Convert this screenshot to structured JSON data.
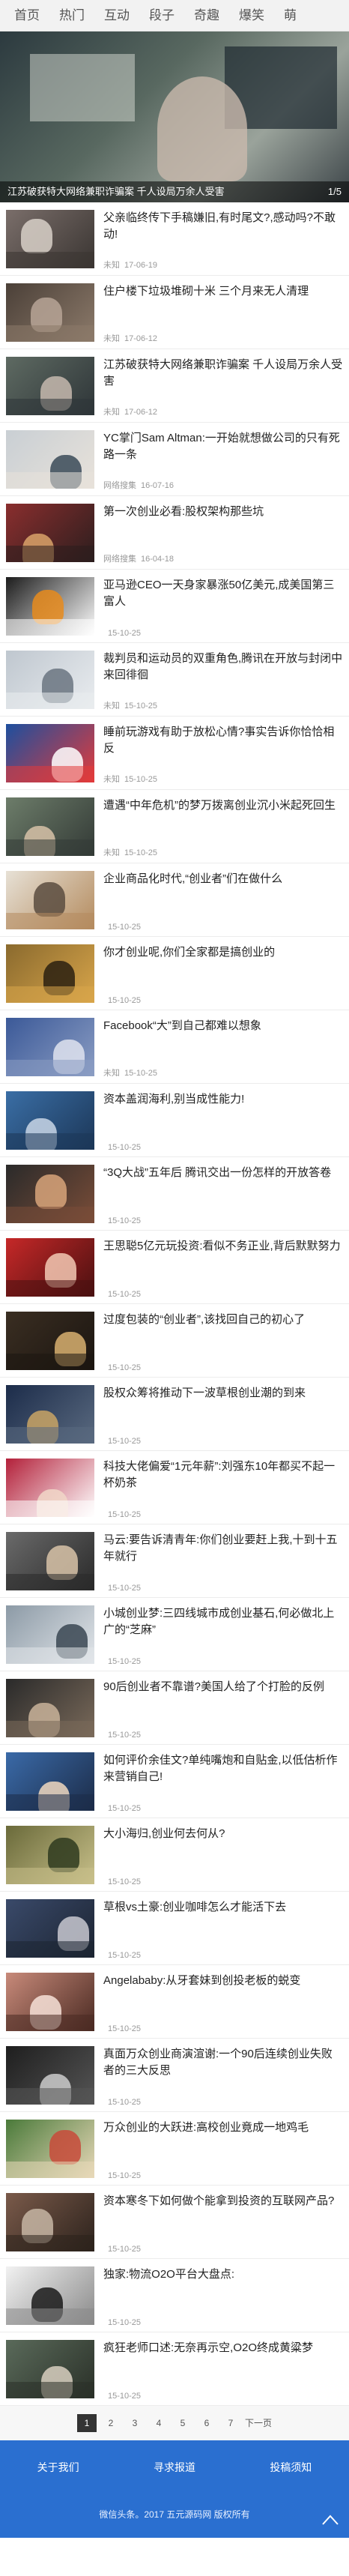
{
  "nav": [
    "首页",
    "热门",
    "互动",
    "段子",
    "奇趣",
    "爆笑",
    "萌"
  ],
  "slide": {
    "caption": "江苏破获特大网络兼职诈骗案 千人设局万余人受害",
    "counter": "1/5"
  },
  "items": [
    {
      "title": "父亲临终传下手稿嫌旧,有时尾文?,感动吗?不敢动!",
      "source": "未知",
      "date": "17-06-19",
      "colors": [
        "#7a6e6a",
        "#d8d0c8",
        "#3a3532"
      ]
    },
    {
      "title": "住户楼下垃圾堆砌十米 三个月来无人清理",
      "source": "未知",
      "date": "17-06-12",
      "colors": [
        "#4b4038",
        "#b7a596",
        "#8c7a6a"
      ]
    },
    {
      "title": "江苏破获特大网络兼职诈骗案 千人设局万余人受害",
      "source": "未知",
      "date": "17-06-12",
      "colors": [
        "#5e6a62",
        "#c6b9ae",
        "#2e3538"
      ]
    },
    {
      "title": "YC掌门Sam Altman:一开始就想做公司的只有死路一条",
      "source": "网络搜集",
      "date": "16-07-16",
      "colors": [
        "#c9cfd4",
        "#3a4a58",
        "#e8e2da"
      ]
    },
    {
      "title": "第一次创业必看:股权架构那些坑",
      "source": "网络搜集",
      "date": "16-04-18",
      "colors": [
        "#8a2e2e",
        "#d9a36a",
        "#2c1e1e"
      ]
    },
    {
      "title": "亚马逊CEO一天身家暴涨50亿美元,成美国第三富人",
      "source": "",
      "date": "15-10-25",
      "colors": [
        "#1c1c1c",
        "#e88b1c",
        "#ffffff"
      ]
    },
    {
      "title": "裁判员和运动员的双重角色,腾讯在开放与封闭中来回徘徊",
      "source": "未知",
      "date": "15-10-25",
      "colors": [
        "#bfc7cf",
        "#6a7480",
        "#e9ecef"
      ]
    },
    {
      "title": "睡前玩游戏有助于放松心情?事实告诉你恰恰相反",
      "source": "未知",
      "date": "15-10-25",
      "colors": [
        "#1d4f9e",
        "#ffffff",
        "#e23b3b"
      ]
    },
    {
      "title": "遭遇“中年危机”的梦万拨离创业沉小米起死回生",
      "source": "未知",
      "date": "15-10-25",
      "colors": [
        "#6d7d6a",
        "#d7c2a8",
        "#333a36"
      ]
    },
    {
      "title": "企业商品化时代,“创业者”们在做什么",
      "source": "",
      "date": "15-10-25",
      "colors": [
        "#e7e1d6",
        "#5a4c40",
        "#b48b5e"
      ]
    },
    {
      "title": "你才创业呢,你们全家都是搞创业的",
      "source": "",
      "date": "15-10-25",
      "colors": [
        "#8a6a2e",
        "#2a2010",
        "#d8a54a"
      ]
    },
    {
      "title": "Facebook“大”到自己都难以想象",
      "source": "未知",
      "date": "15-10-25",
      "colors": [
        "#3b5998",
        "#dfe3ee",
        "#8b9dc3"
      ]
    },
    {
      "title": "资本盖润海利,别当成性能力!",
      "source": "",
      "date": "15-10-25",
      "colors": [
        "#3a6ea5",
        "#c9d6e6",
        "#1c3758"
      ]
    },
    {
      "title": "“3Q大战”五年后 腾讯交出一份怎样的开放答卷",
      "source": "",
      "date": "15-10-25",
      "colors": [
        "#2a2a2a",
        "#d8a57a",
        "#7a4d38"
      ]
    },
    {
      "title": "王思聪5亿元玩投资:看似不务正业,背后默默努力",
      "source": "",
      "date": "15-10-25",
      "colors": [
        "#c62828",
        "#f3c9b4",
        "#4a1010"
      ]
    },
    {
      "title": "过度包装的“创业者”,该找回自己的初心了",
      "source": "",
      "date": "15-10-25",
      "colors": [
        "#3a2e22",
        "#d8b070",
        "#1b1510"
      ]
    },
    {
      "title": "股权众筹将推动下一波草根创业潮的到来",
      "source": "",
      "date": "15-10-25",
      "colors": [
        "#1c2c4a",
        "#c9a565",
        "#5a6a80"
      ]
    },
    {
      "title": "科技大佬偏爱“1元年薪”:刘强东10年都买不起一杯奶茶",
      "source": "",
      "date": "15-10-25",
      "colors": [
        "#b3203a",
        "#f1d7c8",
        "#fff"
      ]
    },
    {
      "title": "马云:要告诉清青年:你们创业要赶上我,十到十五年就行",
      "source": "",
      "date": "15-10-25",
      "colors": [
        "#6a6a6a",
        "#d8c3a8",
        "#2a2a2a"
      ]
    },
    {
      "title": "小城创业梦:三四线城市成创业基石,何必做北上广的“芝麻”",
      "source": "",
      "date": "15-10-25",
      "colors": [
        "#8c9aa6",
        "#3a4652",
        "#e2e6ea"
      ]
    },
    {
      "title": "90后创业者不靠谱?美国人给了个打脸的反例",
      "source": "",
      "date": "15-10-25",
      "colors": [
        "#2a2a2a",
        "#c9b39a",
        "#7a6a5a"
      ]
    },
    {
      "title": "如何评价余佳文?单纯嘴炮和自贴金,以低估析作来营销自己!",
      "source": "",
      "date": "15-10-25",
      "colors": [
        "#3a6aa8",
        "#f0d8c0",
        "#1c2c48"
      ]
    },
    {
      "title": "大小海归,创业何去何从?",
      "source": "",
      "date": "15-10-25",
      "colors": [
        "#6a6a3a",
        "#2e3a1e",
        "#c8c08a"
      ]
    },
    {
      "title": "草根vs土豪:创业咖啡怎么才能活下去",
      "source": "",
      "date": "15-10-25",
      "colors": [
        "#3a4a6a",
        "#c8c8d0",
        "#1c2432"
      ]
    },
    {
      "title": "Angelababy:从牙套妹到创投老板的蜕变",
      "source": "",
      "date": "15-10-25",
      "colors": [
        "#c88a7a",
        "#f7e2d8",
        "#4a2a22"
      ]
    },
    {
      "title": "真面万众创业商演渲谢:一个90后连续创业失败者的三大反思",
      "source": "",
      "date": "15-10-25",
      "colors": [
        "#1e1e1e",
        "#cccccc",
        "#555555"
      ]
    },
    {
      "title": "万众创业的大跃进:高校创业竟成一地鸡毛",
      "source": "",
      "date": "15-10-25",
      "colors": [
        "#4a7a3a",
        "#c84a3a",
        "#e8d8b8"
      ]
    },
    {
      "title": "资本寒冬下如何做个能拿到投资的互联网产品?",
      "source": "",
      "date": "15-10-25",
      "colors": [
        "#7a5a4a",
        "#c7b6a4",
        "#2c221c"
      ]
    },
    {
      "title": "独家:物流O2O平台大盘点:",
      "source": "",
      "date": "15-10-25",
      "colors": [
        "#f2f2f2",
        "#1a1a1a",
        "#8a8a8a"
      ]
    },
    {
      "title": "疯狂老师口述:无奈再示空,O2O终成黄粱梦",
      "source": "",
      "date": "15-10-25",
      "colors": [
        "#5a6a5a",
        "#d8cfc0",
        "#2a3028"
      ]
    }
  ],
  "pager": {
    "pages": [
      "1",
      "2",
      "3",
      "4",
      "5",
      "6",
      "7"
    ],
    "current": "1",
    "next_label": "下一页"
  },
  "footer": {
    "links": [
      "关于我们",
      "寻求报道",
      "投稿须知"
    ],
    "copyright": "微信头条。2017 五元源码网 版权所有"
  }
}
